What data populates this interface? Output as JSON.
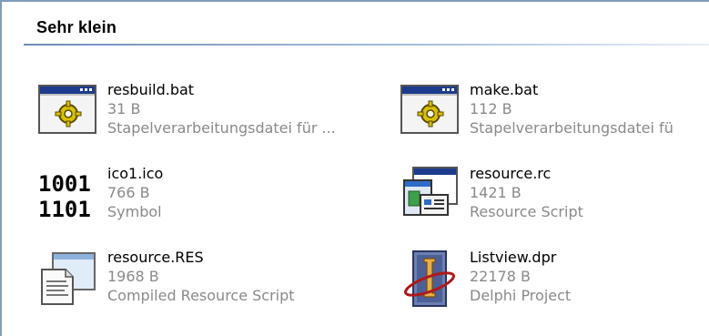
{
  "group": {
    "title": "Sehr klein"
  },
  "files": [
    {
      "name": "resbuild.bat",
      "size": "31 B",
      "type": "Stapelverarbeitungsdatei für ...",
      "icon": "batch-file-gear-icon"
    },
    {
      "name": "make.bat",
      "size": "112 B",
      "type": "Stapelverarbeitungsdatei fü",
      "icon": "batch-file-gear-icon"
    },
    {
      "name": "ico1.ico",
      "size": "766 B",
      "type": "Symbol",
      "icon": "binary-icon-file-icon",
      "glyph": [
        "1001",
        "1101"
      ]
    },
    {
      "name": "resource.rc",
      "size": "1421 B",
      "type": "Resource Script",
      "icon": "resource-script-icon"
    },
    {
      "name": "resource.RES",
      "size": "1968 B",
      "type": "Compiled Resource Script",
      "icon": "compiled-resource-icon"
    },
    {
      "name": "Listview.dpr",
      "size": "22178 B",
      "type": "Delphi Project",
      "icon": "delphi-project-icon"
    }
  ]
}
